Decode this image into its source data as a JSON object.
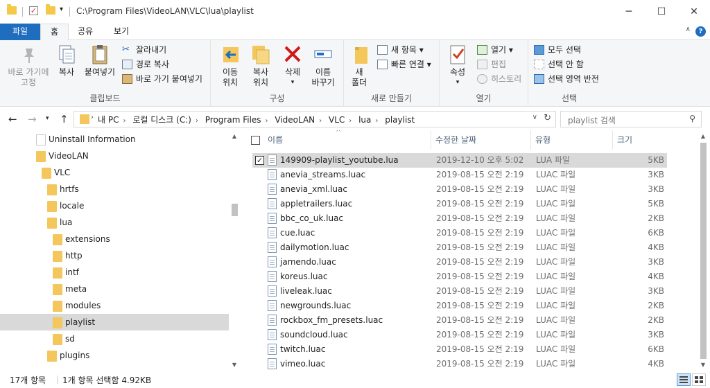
{
  "window": {
    "title": "C:\\Program Files\\VideoLAN\\VLC\\lua\\playlist",
    "minimize": "─",
    "maximize": "☐",
    "close": "✕"
  },
  "ribbon_tabs": {
    "file": "파일",
    "home": "홈",
    "share": "공유",
    "view": "보기"
  },
  "ribbon": {
    "clipboard": {
      "label": "클립보드",
      "pin": "바로 가기에\n고정",
      "copy": "복사",
      "paste": "붙여넣기",
      "cut": "잘라내기",
      "copy_path": "경로 복사",
      "paste_shortcut": "바로 가기 붙여넣기"
    },
    "organize": {
      "label": "구성",
      "move_to": "이동\n위치",
      "copy_to": "복사\n위치",
      "delete": "삭제",
      "rename": "이름\n바꾸기"
    },
    "new": {
      "label": "새로 만들기",
      "new_folder": "새\n폴더",
      "new_item": "새 항목",
      "easy_access": "빠른 연결"
    },
    "open": {
      "label": "열기",
      "properties": "속성",
      "open": "열기",
      "edit": "편집",
      "history": "히스토리"
    },
    "select": {
      "label": "선택",
      "select_all": "모두 선택",
      "select_none": "선택 안 함",
      "invert": "선택 영역 반전"
    }
  },
  "address_bar": {
    "crumbs": [
      "내 PC",
      "로컬 디스크 (C:)",
      "Program Files",
      "VideoLAN",
      "VLC",
      "lua",
      "playlist"
    ],
    "search_placeholder": "playlist 검색"
  },
  "tree": [
    {
      "label": "Uninstall Information",
      "indent": 1,
      "white": true,
      "selected": false
    },
    {
      "label": "VideoLAN",
      "indent": 1,
      "white": false,
      "selected": false
    },
    {
      "label": "VLC",
      "indent": 2,
      "white": false,
      "selected": false
    },
    {
      "label": "hrtfs",
      "indent": 3,
      "white": false,
      "selected": false
    },
    {
      "label": "locale",
      "indent": 3,
      "white": false,
      "selected": false
    },
    {
      "label": "lua",
      "indent": 3,
      "white": false,
      "selected": false
    },
    {
      "label": "extensions",
      "indent": 4,
      "white": false,
      "selected": false
    },
    {
      "label": "http",
      "indent": 4,
      "white": false,
      "selected": false
    },
    {
      "label": "intf",
      "indent": 4,
      "white": false,
      "selected": false
    },
    {
      "label": "meta",
      "indent": 4,
      "white": false,
      "selected": false
    },
    {
      "label": "modules",
      "indent": 4,
      "white": false,
      "selected": false
    },
    {
      "label": "playlist",
      "indent": 4,
      "white": false,
      "selected": true
    },
    {
      "label": "sd",
      "indent": 4,
      "white": false,
      "selected": false
    },
    {
      "label": "plugins",
      "indent": 3,
      "white": false,
      "selected": false
    }
  ],
  "columns": {
    "name": "이름",
    "date": "수정한 날짜",
    "type": "유형",
    "size": "크기"
  },
  "files": [
    {
      "name": "149909-playlist_youtube.lua",
      "date": "2019-12-10 오후 5:02",
      "type": "LUA 파일",
      "size": "5KB",
      "selected": true,
      "checked": true
    },
    {
      "name": "anevia_streams.luac",
      "date": "2019-08-15 오전 2:19",
      "type": "LUAC 파일",
      "size": "3KB",
      "selected": false,
      "checked": false
    },
    {
      "name": "anevia_xml.luac",
      "date": "2019-08-15 오전 2:19",
      "type": "LUAC 파일",
      "size": "3KB",
      "selected": false,
      "checked": false
    },
    {
      "name": "appletrailers.luac",
      "date": "2019-08-15 오전 2:19",
      "type": "LUAC 파일",
      "size": "5KB",
      "selected": false,
      "checked": false
    },
    {
      "name": "bbc_co_uk.luac",
      "date": "2019-08-15 오전 2:19",
      "type": "LUAC 파일",
      "size": "2KB",
      "selected": false,
      "checked": false
    },
    {
      "name": "cue.luac",
      "date": "2019-08-15 오전 2:19",
      "type": "LUAC 파일",
      "size": "6KB",
      "selected": false,
      "checked": false
    },
    {
      "name": "dailymotion.luac",
      "date": "2019-08-15 오전 2:19",
      "type": "LUAC 파일",
      "size": "4KB",
      "selected": false,
      "checked": false
    },
    {
      "name": "jamendo.luac",
      "date": "2019-08-15 오전 2:19",
      "type": "LUAC 파일",
      "size": "3KB",
      "selected": false,
      "checked": false
    },
    {
      "name": "koreus.luac",
      "date": "2019-08-15 오전 2:19",
      "type": "LUAC 파일",
      "size": "4KB",
      "selected": false,
      "checked": false
    },
    {
      "name": "liveleak.luac",
      "date": "2019-08-15 오전 2:19",
      "type": "LUAC 파일",
      "size": "3KB",
      "selected": false,
      "checked": false
    },
    {
      "name": "newgrounds.luac",
      "date": "2019-08-15 오전 2:19",
      "type": "LUAC 파일",
      "size": "2KB",
      "selected": false,
      "checked": false
    },
    {
      "name": "rockbox_fm_presets.luac",
      "date": "2019-08-15 오전 2:19",
      "type": "LUAC 파일",
      "size": "2KB",
      "selected": false,
      "checked": false
    },
    {
      "name": "soundcloud.luac",
      "date": "2019-08-15 오전 2:19",
      "type": "LUAC 파일",
      "size": "3KB",
      "selected": false,
      "checked": false
    },
    {
      "name": "twitch.luac",
      "date": "2019-08-15 오전 2:19",
      "type": "LUAC 파일",
      "size": "6KB",
      "selected": false,
      "checked": false
    },
    {
      "name": "vimeo.luac",
      "date": "2019-08-15 오전 2:19",
      "type": "LUAC 파일",
      "size": "4KB",
      "selected": false,
      "checked": false
    }
  ],
  "status": {
    "item_count": "17개 항목",
    "selection": "1개 항목 선택함 4.92KB"
  },
  "colors": {
    "file_tab": "#1f6dbf",
    "folder": "#f3c75b",
    "selection": "#d9d9d9"
  }
}
